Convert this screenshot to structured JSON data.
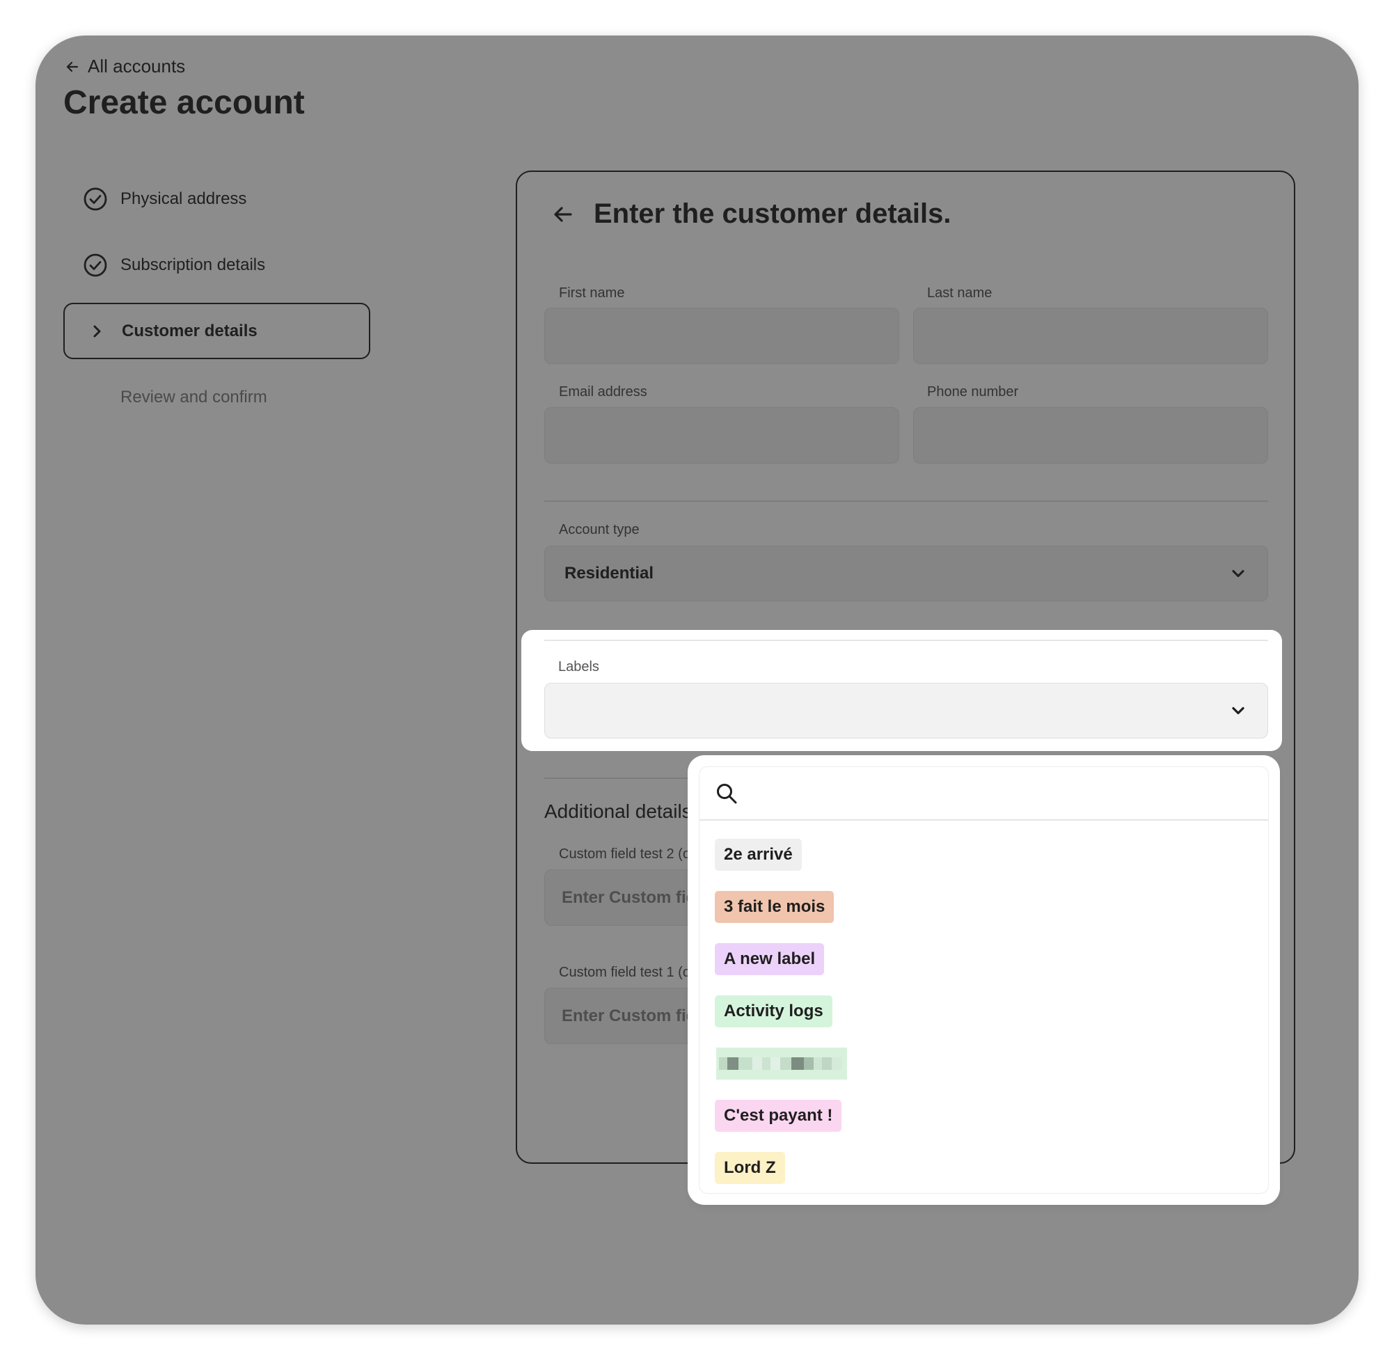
{
  "nav": {
    "back_label": "All accounts",
    "title": "Create account"
  },
  "steps": [
    {
      "label": "Physical address",
      "state": "complete",
      "icon": "check-circle-icon"
    },
    {
      "label": "Subscription details",
      "state": "complete",
      "icon": "check-circle-icon"
    },
    {
      "label": "Customer details",
      "state": "active",
      "icon": "chevron-right-icon"
    },
    {
      "label": "Review and confirm",
      "state": "pending"
    }
  ],
  "form": {
    "heading": "Enter the customer details.",
    "first_name_label": "First name",
    "last_name_label": "Last name",
    "email_label": "Email address",
    "phone_label": "Phone number",
    "account_type_label": "Account type",
    "account_type_value": "Residential",
    "labels_label": "Labels",
    "additional_title": "Additional details",
    "custom_fields": [
      {
        "label": "Custom field test 2 (o",
        "placeholder": "Enter Custom fiel"
      },
      {
        "label": "Custom field test 1 (o",
        "placeholder": "Enter Custom fiel"
      }
    ]
  },
  "labels_dropdown": {
    "search_placeholder": "",
    "options": [
      {
        "text": "2e arrivé",
        "color": "#efefef"
      },
      {
        "text": "3 fait le mois",
        "color": "#f0c4ad"
      },
      {
        "text": "A new label",
        "color": "#ecd2fa"
      },
      {
        "text": "Activity logs",
        "color": "#d5f4dc"
      },
      {
        "text": "",
        "color": "#d8f1dc",
        "redacted": true
      },
      {
        "text": "C'est payant !",
        "color": "#fbd6f1"
      },
      {
        "text": "Lord Z",
        "color": "#fdf1c6"
      }
    ]
  },
  "colors": {
    "overlay": "#8c8c8c",
    "text": "#1f1f1f",
    "panel": "#ffffff"
  }
}
